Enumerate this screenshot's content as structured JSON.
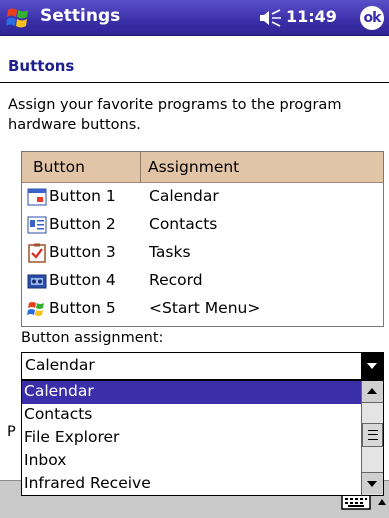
{
  "titlebar": {
    "app_title": "Settings",
    "time": "11:49",
    "ok_label": "ok"
  },
  "page": {
    "heading": "Buttons",
    "description": "Assign your favorite programs to the program hardware buttons."
  },
  "table": {
    "headers": {
      "button": "Button",
      "assignment": "Assignment"
    },
    "rows": [
      {
        "button": "Button 1",
        "assignment": "Calendar",
        "icon": "calendar-icon"
      },
      {
        "button": "Button 2",
        "assignment": "Contacts",
        "icon": "contacts-icon"
      },
      {
        "button": "Button 3",
        "assignment": "Tasks",
        "icon": "tasks-icon"
      },
      {
        "button": "Button 4",
        "assignment": "Record",
        "icon": "record-icon"
      },
      {
        "button": "Button 5",
        "assignment": "<Start Menu>",
        "icon": "start-menu-icon"
      }
    ]
  },
  "assignment": {
    "label": "Button assignment:",
    "selected_value": "Calendar",
    "options": [
      "Calendar",
      "Contacts",
      "File Explorer",
      "Inbox",
      "Infrared Receive"
    ],
    "selected_index": 0
  },
  "background": {
    "partial_text": "P"
  },
  "colors": {
    "titlebar": "#3a2fa8",
    "heading_text": "#1e1e8c",
    "table_header": "#e2c4a6",
    "selection": "#3a2fa8"
  }
}
